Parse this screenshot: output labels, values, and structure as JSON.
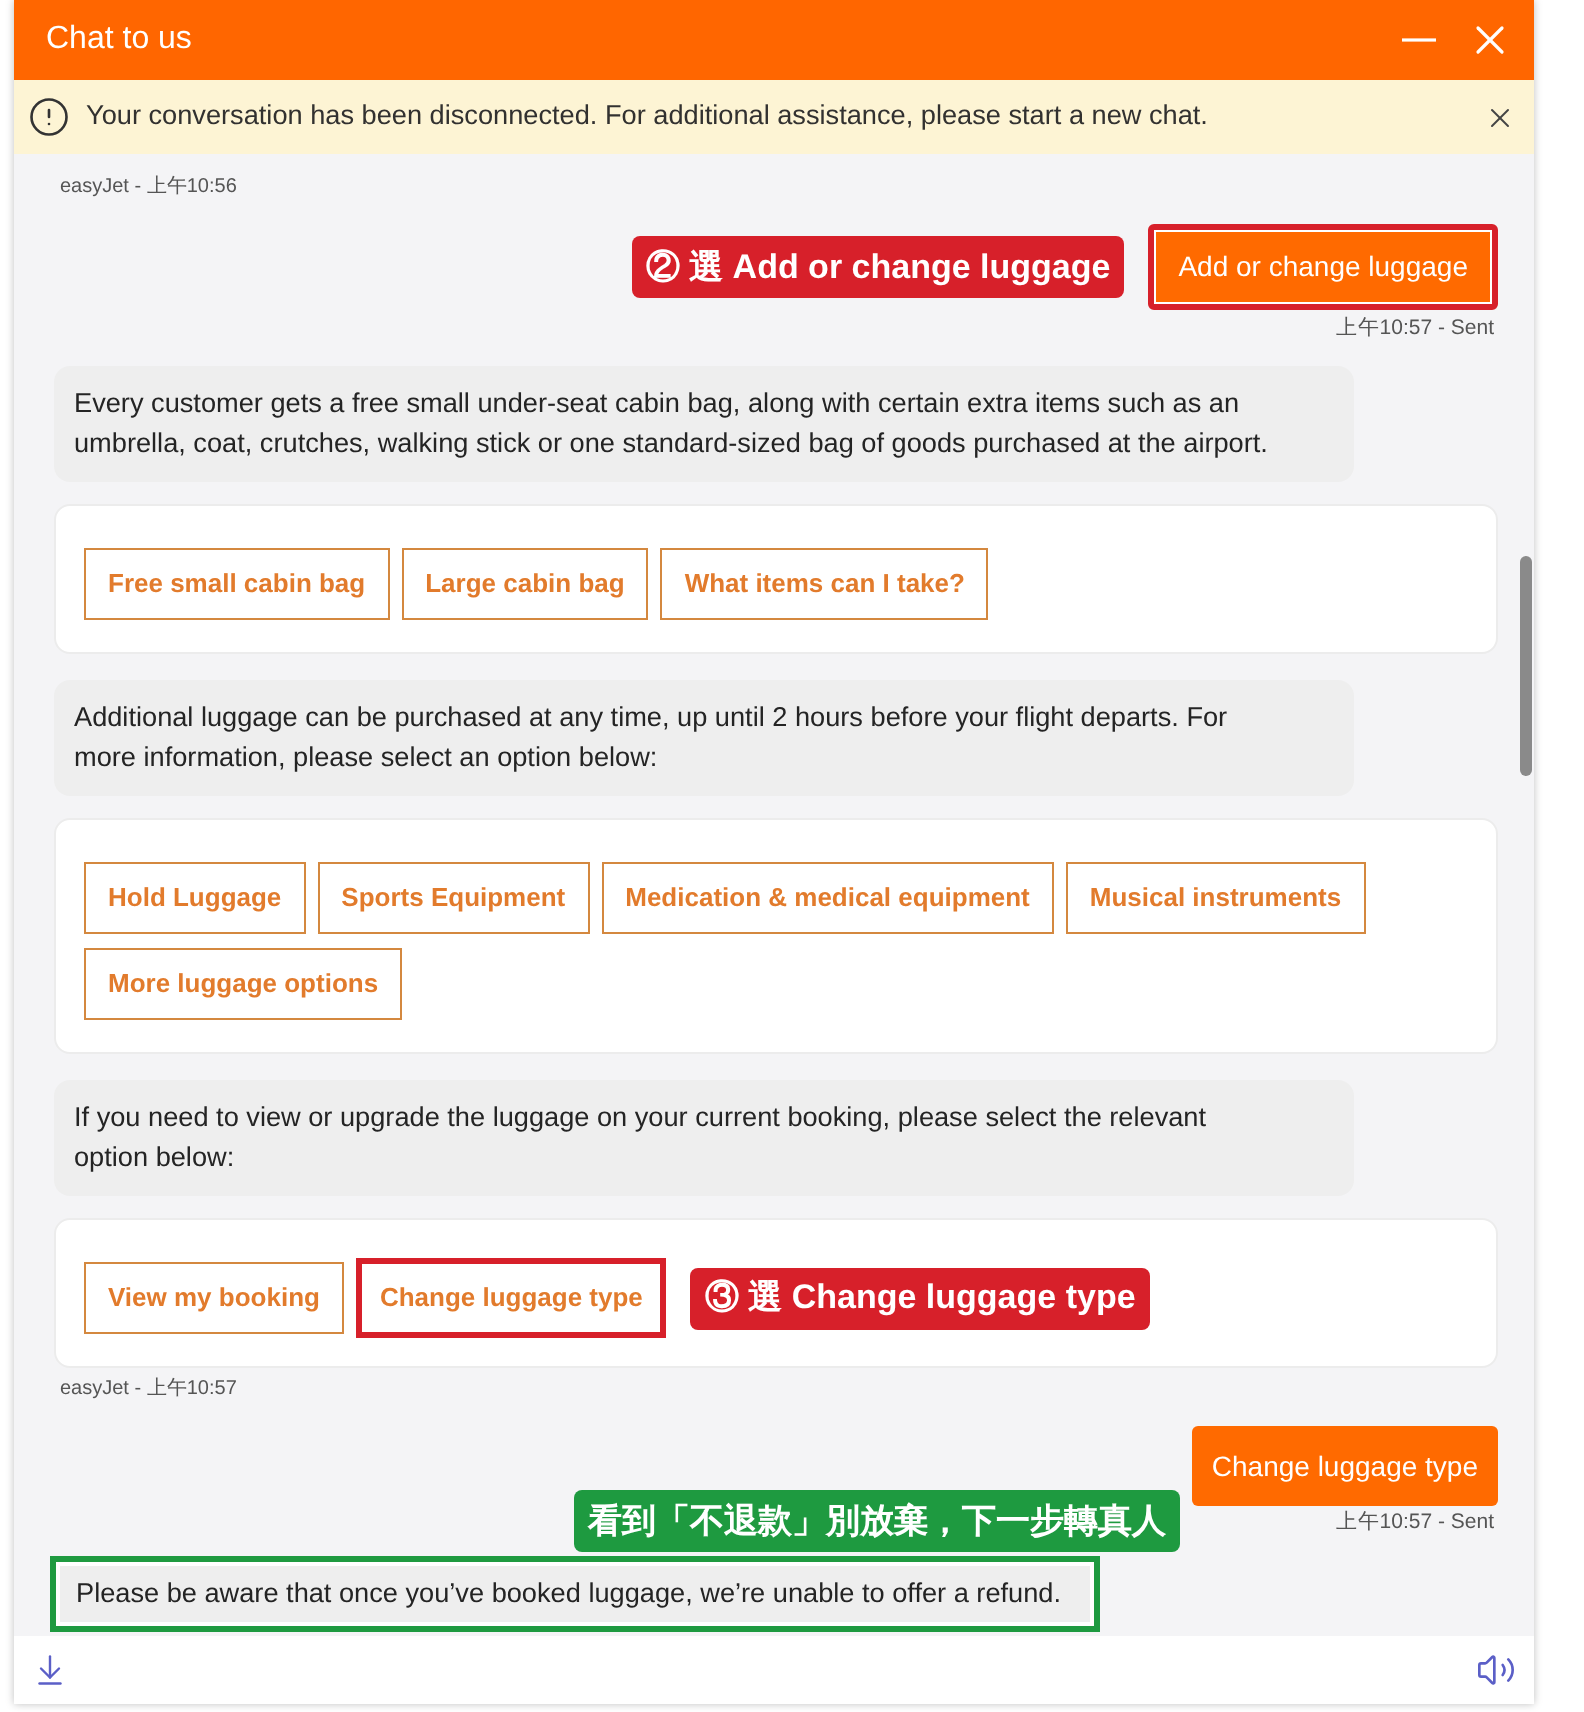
{
  "window": {
    "title": "Chat to us"
  },
  "notice": {
    "text": "Your conversation has been disconnected. For additional assistance, please start a new chat."
  },
  "messages": [
    {
      "kind": "meta",
      "text": "easyJet - 上午10:56"
    },
    {
      "kind": "user",
      "text": "Add or change luggage",
      "status": "上午10:57 - Sent",
      "highlighted": true,
      "highlight": {
        "color": "#d7202a"
      },
      "annotation": {
        "text": "② 選 Add or change luggage",
        "color": "#d7202a"
      }
    },
    {
      "kind": "bot",
      "text": "Every customer gets a free small under-seat cabin bag, along with certain extra items such as an umbrella, coat, crutches, walking stick or one standard-sized bag of goods purchased at the airport.",
      "highlighted": false
    },
    {
      "kind": "options",
      "options": [
        {
          "label": "Free small cabin bag",
          "highlighted": false
        },
        {
          "label": "Large cabin bag",
          "highlighted": false
        },
        {
          "label": "What items can I take?",
          "highlighted": false
        }
      ]
    },
    {
      "kind": "bot",
      "text": "Additional luggage can be purchased at any time, up until 2 hours before your flight departs. For more information, please select an option below:",
      "highlighted": false
    },
    {
      "kind": "options",
      "options": [
        {
          "label": "Hold Luggage",
          "highlighted": false
        },
        {
          "label": "Sports Equipment",
          "highlighted": false
        },
        {
          "label": "Medication & medical equipment",
          "highlighted": false
        },
        {
          "label": "Musical instruments",
          "highlighted": false
        },
        {
          "label": "More luggage options",
          "highlighted": false
        }
      ]
    },
    {
      "kind": "bot",
      "text": "If you need to view or upgrade the luggage on your current booking, please select the relevant option below:",
      "highlighted": false
    },
    {
      "kind": "options",
      "options": [
        {
          "label": "View my booking",
          "highlighted": false
        },
        {
          "label": "Change luggage type",
          "highlighted": true,
          "highlight": {
            "color": "#d7202a"
          }
        }
      ],
      "annotation": {
        "text": "③ 選 Change luggage type",
        "color": "#d7202a"
      }
    },
    {
      "kind": "meta",
      "text": "easyJet - 上午10:57"
    },
    {
      "kind": "user",
      "text": "Change luggage type",
      "status": "上午10:57 - Sent",
      "highlighted": false,
      "annotation": {
        "text": "看到「不退款」別放棄，下一步轉真人",
        "color": "#1e9a40"
      }
    },
    {
      "kind": "bot",
      "text": "Please be aware that once you’ve booked luggage, we’re unable to offer a refund.",
      "highlighted": true,
      "highlight": {
        "color": "#1e9a40"
      }
    }
  ]
}
